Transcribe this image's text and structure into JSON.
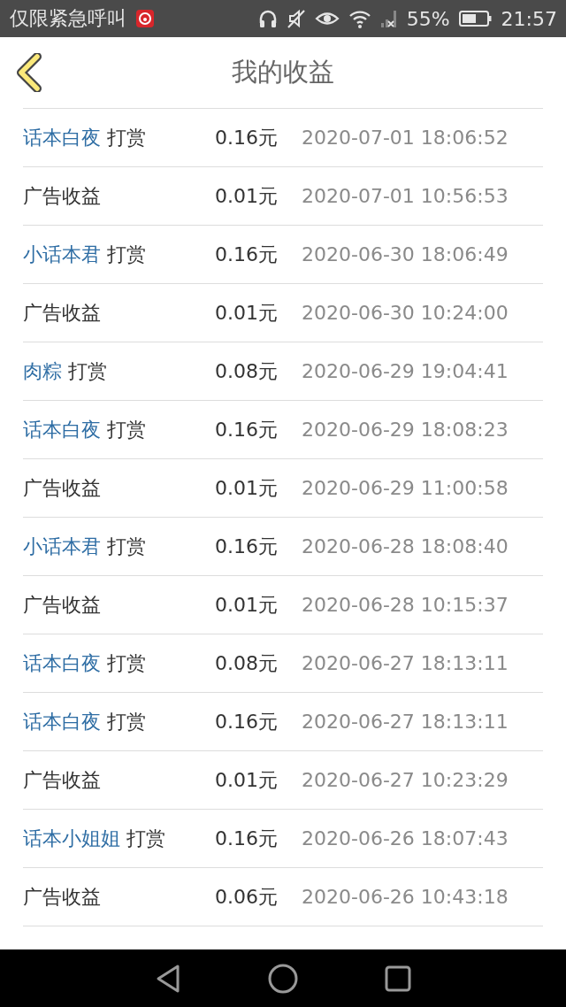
{
  "status_bar": {
    "carrier": "仅限紧急呼叫",
    "battery": "55%",
    "time": "21:57"
  },
  "header": {
    "title": "我的收益"
  },
  "records": [
    {
      "kind": "tip",
      "user": "话本白夜",
      "action": "打赏",
      "amount": "0.16元",
      "time": "2020-07-01 18:06:52"
    },
    {
      "kind": "ad",
      "label": "广告收益",
      "amount": "0.01元",
      "time": "2020-07-01 10:56:53"
    },
    {
      "kind": "tip",
      "user": "小话本君",
      "action": "打赏",
      "amount": "0.16元",
      "time": "2020-06-30 18:06:49"
    },
    {
      "kind": "ad",
      "label": "广告收益",
      "amount": "0.01元",
      "time": "2020-06-30 10:24:00"
    },
    {
      "kind": "tip",
      "user": "肉粽",
      "action": "打赏",
      "amount": "0.08元",
      "time": "2020-06-29 19:04:41"
    },
    {
      "kind": "tip",
      "user": "话本白夜",
      "action": "打赏",
      "amount": "0.16元",
      "time": "2020-06-29 18:08:23"
    },
    {
      "kind": "ad",
      "label": "广告收益",
      "amount": "0.01元",
      "time": "2020-06-29 11:00:58"
    },
    {
      "kind": "tip",
      "user": "小话本君",
      "action": "打赏",
      "amount": "0.16元",
      "time": "2020-06-28 18:08:40"
    },
    {
      "kind": "ad",
      "label": "广告收益",
      "amount": "0.01元",
      "time": "2020-06-28 10:15:37"
    },
    {
      "kind": "tip",
      "user": "话本白夜",
      "action": "打赏",
      "amount": "0.08元",
      "time": "2020-06-27 18:13:11"
    },
    {
      "kind": "tip",
      "user": "话本白夜",
      "action": "打赏",
      "amount": "0.16元",
      "time": "2020-06-27 18:13:11"
    },
    {
      "kind": "ad",
      "label": "广告收益",
      "amount": "0.01元",
      "time": "2020-06-27 10:23:29"
    },
    {
      "kind": "tip",
      "user": "话本小姐姐",
      "action": "打赏",
      "amount": "0.16元",
      "time": "2020-06-26 18:07:43"
    },
    {
      "kind": "ad",
      "label": "广告收益",
      "amount": "0.06元",
      "time": "2020-06-26 10:43:18"
    }
  ]
}
